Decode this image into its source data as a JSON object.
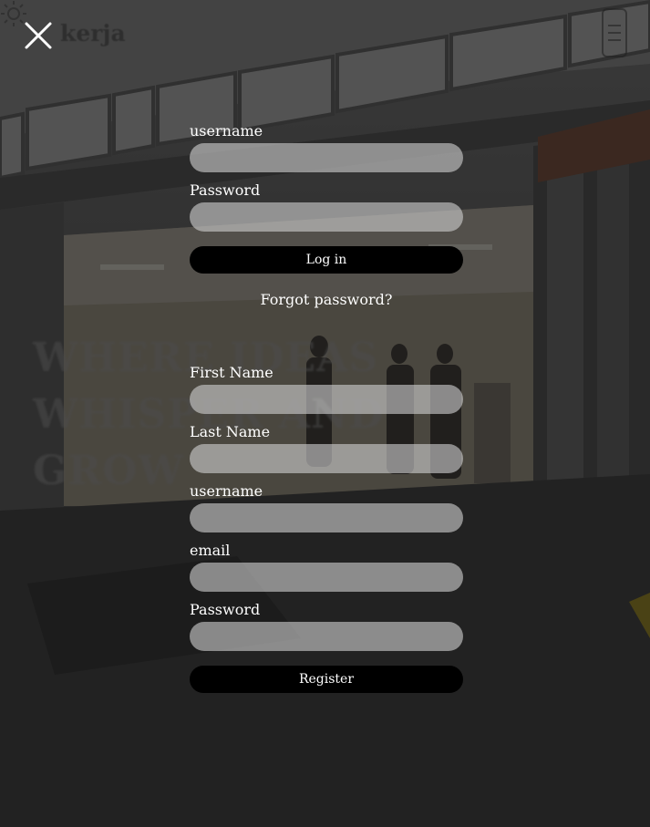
{
  "header": {
    "brand": "kerja",
    "close_icon": "close-icon",
    "theme_icon": "sun-icon",
    "menu_icon": "phone-menu-icon"
  },
  "hero": {
    "headline": "WHERE IDEAS\nWHISPER AND\nGROW"
  },
  "login": {
    "username_label": "username",
    "password_label": "Password",
    "submit_label": "Log in",
    "forgot_label": "Forgot password?"
  },
  "register": {
    "first_name_label": "First Name",
    "last_name_label": "Last Name",
    "username_label": "username",
    "email_label": "email",
    "password_label": "Password",
    "submit_label": "Register"
  },
  "colors": {
    "overlay": "#000000",
    "button": "#000000",
    "input": "#cdcdcd",
    "text": "#ffffff"
  }
}
